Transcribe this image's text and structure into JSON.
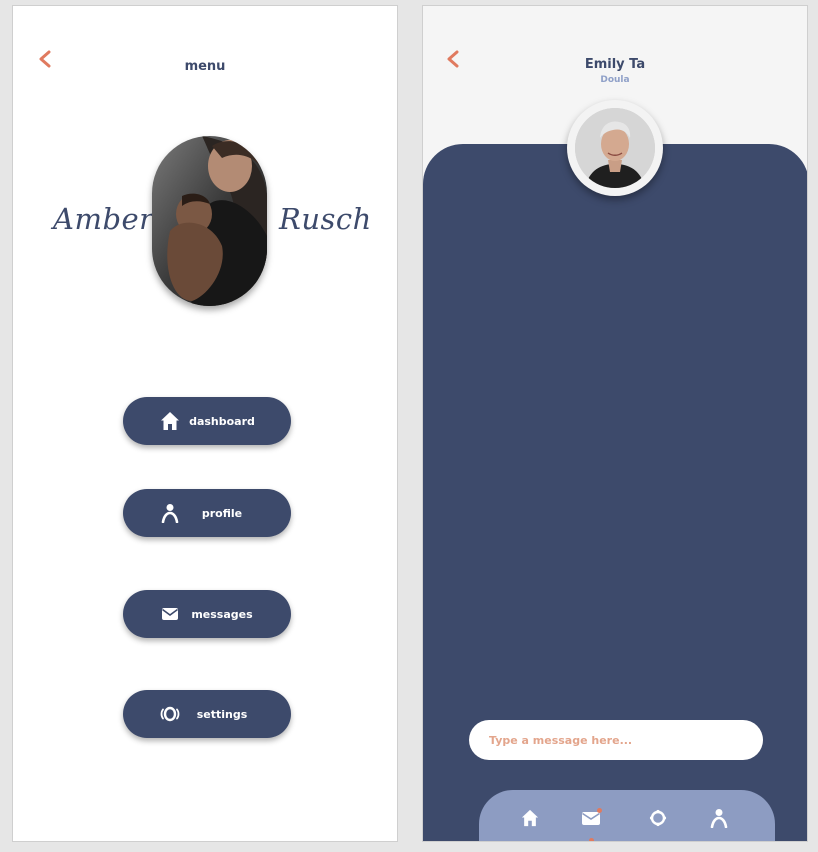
{
  "colors": {
    "navy": "#3d4a6b",
    "accent": "#e07a5f",
    "nav_bar": "#8d9cc2",
    "placeholder": "#e3a58c"
  },
  "menu_screen": {
    "title": "menu",
    "back_icon": "chevron-left-icon",
    "profile": {
      "first_name": "Amber",
      "last_name": "Rusch",
      "photo": "mother-and-baby-photo"
    },
    "buttons": [
      {
        "label": "dashboard",
        "icon": "home-icon"
      },
      {
        "label": "profile",
        "icon": "person-icon"
      },
      {
        "label": "messages",
        "icon": "envelope-icon"
      },
      {
        "label": "settings",
        "icon": "vibration-icon"
      }
    ]
  },
  "chat_screen": {
    "back_icon": "chevron-left-icon",
    "contact": {
      "name": "Emily Ta",
      "role": "Doula",
      "photo": "contact-avatar-photo"
    },
    "message_input": {
      "placeholder": "Type a message here..."
    },
    "bottom_nav": [
      {
        "icon": "home-icon",
        "active": false
      },
      {
        "icon": "envelope-icon",
        "active": true,
        "badge": true
      },
      {
        "icon": "vibration-icon",
        "active": false
      },
      {
        "icon": "person-icon",
        "active": false
      }
    ]
  }
}
